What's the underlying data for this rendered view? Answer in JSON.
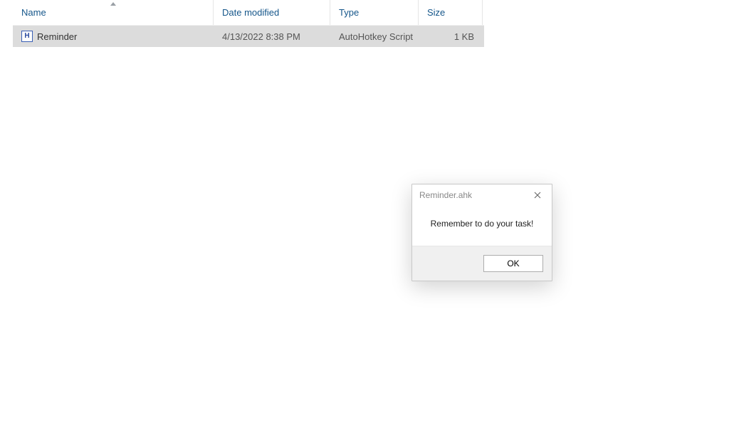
{
  "columns": {
    "name": "Name",
    "date": "Date modified",
    "type": "Type",
    "size": "Size"
  },
  "files": [
    {
      "icon_letter": "H",
      "name": "Reminder",
      "date": "4/13/2022 8:38 PM",
      "type": "AutoHotkey Script",
      "size": "1 KB"
    }
  ],
  "dialog": {
    "title": "Reminder.ahk",
    "message": "Remember to do your task!",
    "ok_label": "OK"
  }
}
